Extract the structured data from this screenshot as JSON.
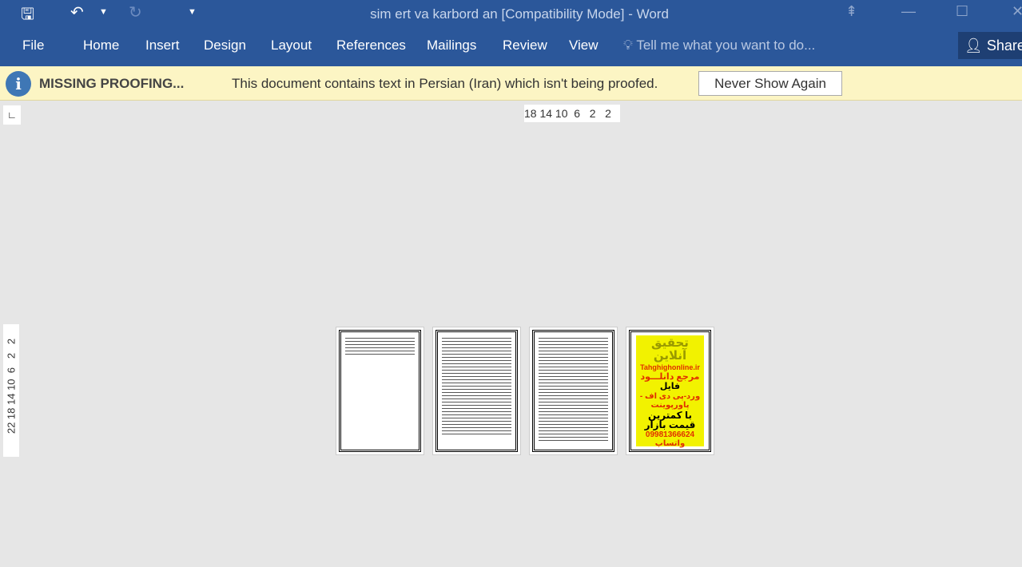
{
  "window": {
    "title": "sim ert va karbord an [Compatibility Mode] - Word"
  },
  "quick_access": {
    "save_icon": "save-icon",
    "undo_icon": "undo-icon",
    "redo_icon": "redo-icon",
    "customize_icon": "dropdown-icon"
  },
  "ribbon": {
    "tabs": [
      "File",
      "Home",
      "Insert",
      "Design",
      "Layout",
      "References",
      "Mailings",
      "Review",
      "View"
    ],
    "tell_me": "Tell me what you want to do...",
    "share": "Share"
  },
  "message_bar": {
    "title": "MISSING PROOFING...",
    "message": "This document contains text in Persian (Iran) which isn't being proofed.",
    "button": "Never Show Again"
  },
  "rulers": {
    "horizontal": "18 14 10  6   2   2",
    "vertical": "22 18 14 10  6   2   2"
  },
  "pages": {
    "ad": {
      "l1": "تحقیق آنلاین",
      "l2": "Tahghighonline.ir",
      "l3": "مرجع دانلـــود",
      "l4": "فایل",
      "l5": "ورد-پی دی اف - پاورپوینت",
      "l6": "با کمترین قیمت بازار",
      "l7": "09981366624 واتساپ"
    }
  },
  "colors": {
    "ribbon": "#2b579a",
    "message_bar": "#fcf5c4",
    "canvas": "#e6e6e6"
  }
}
